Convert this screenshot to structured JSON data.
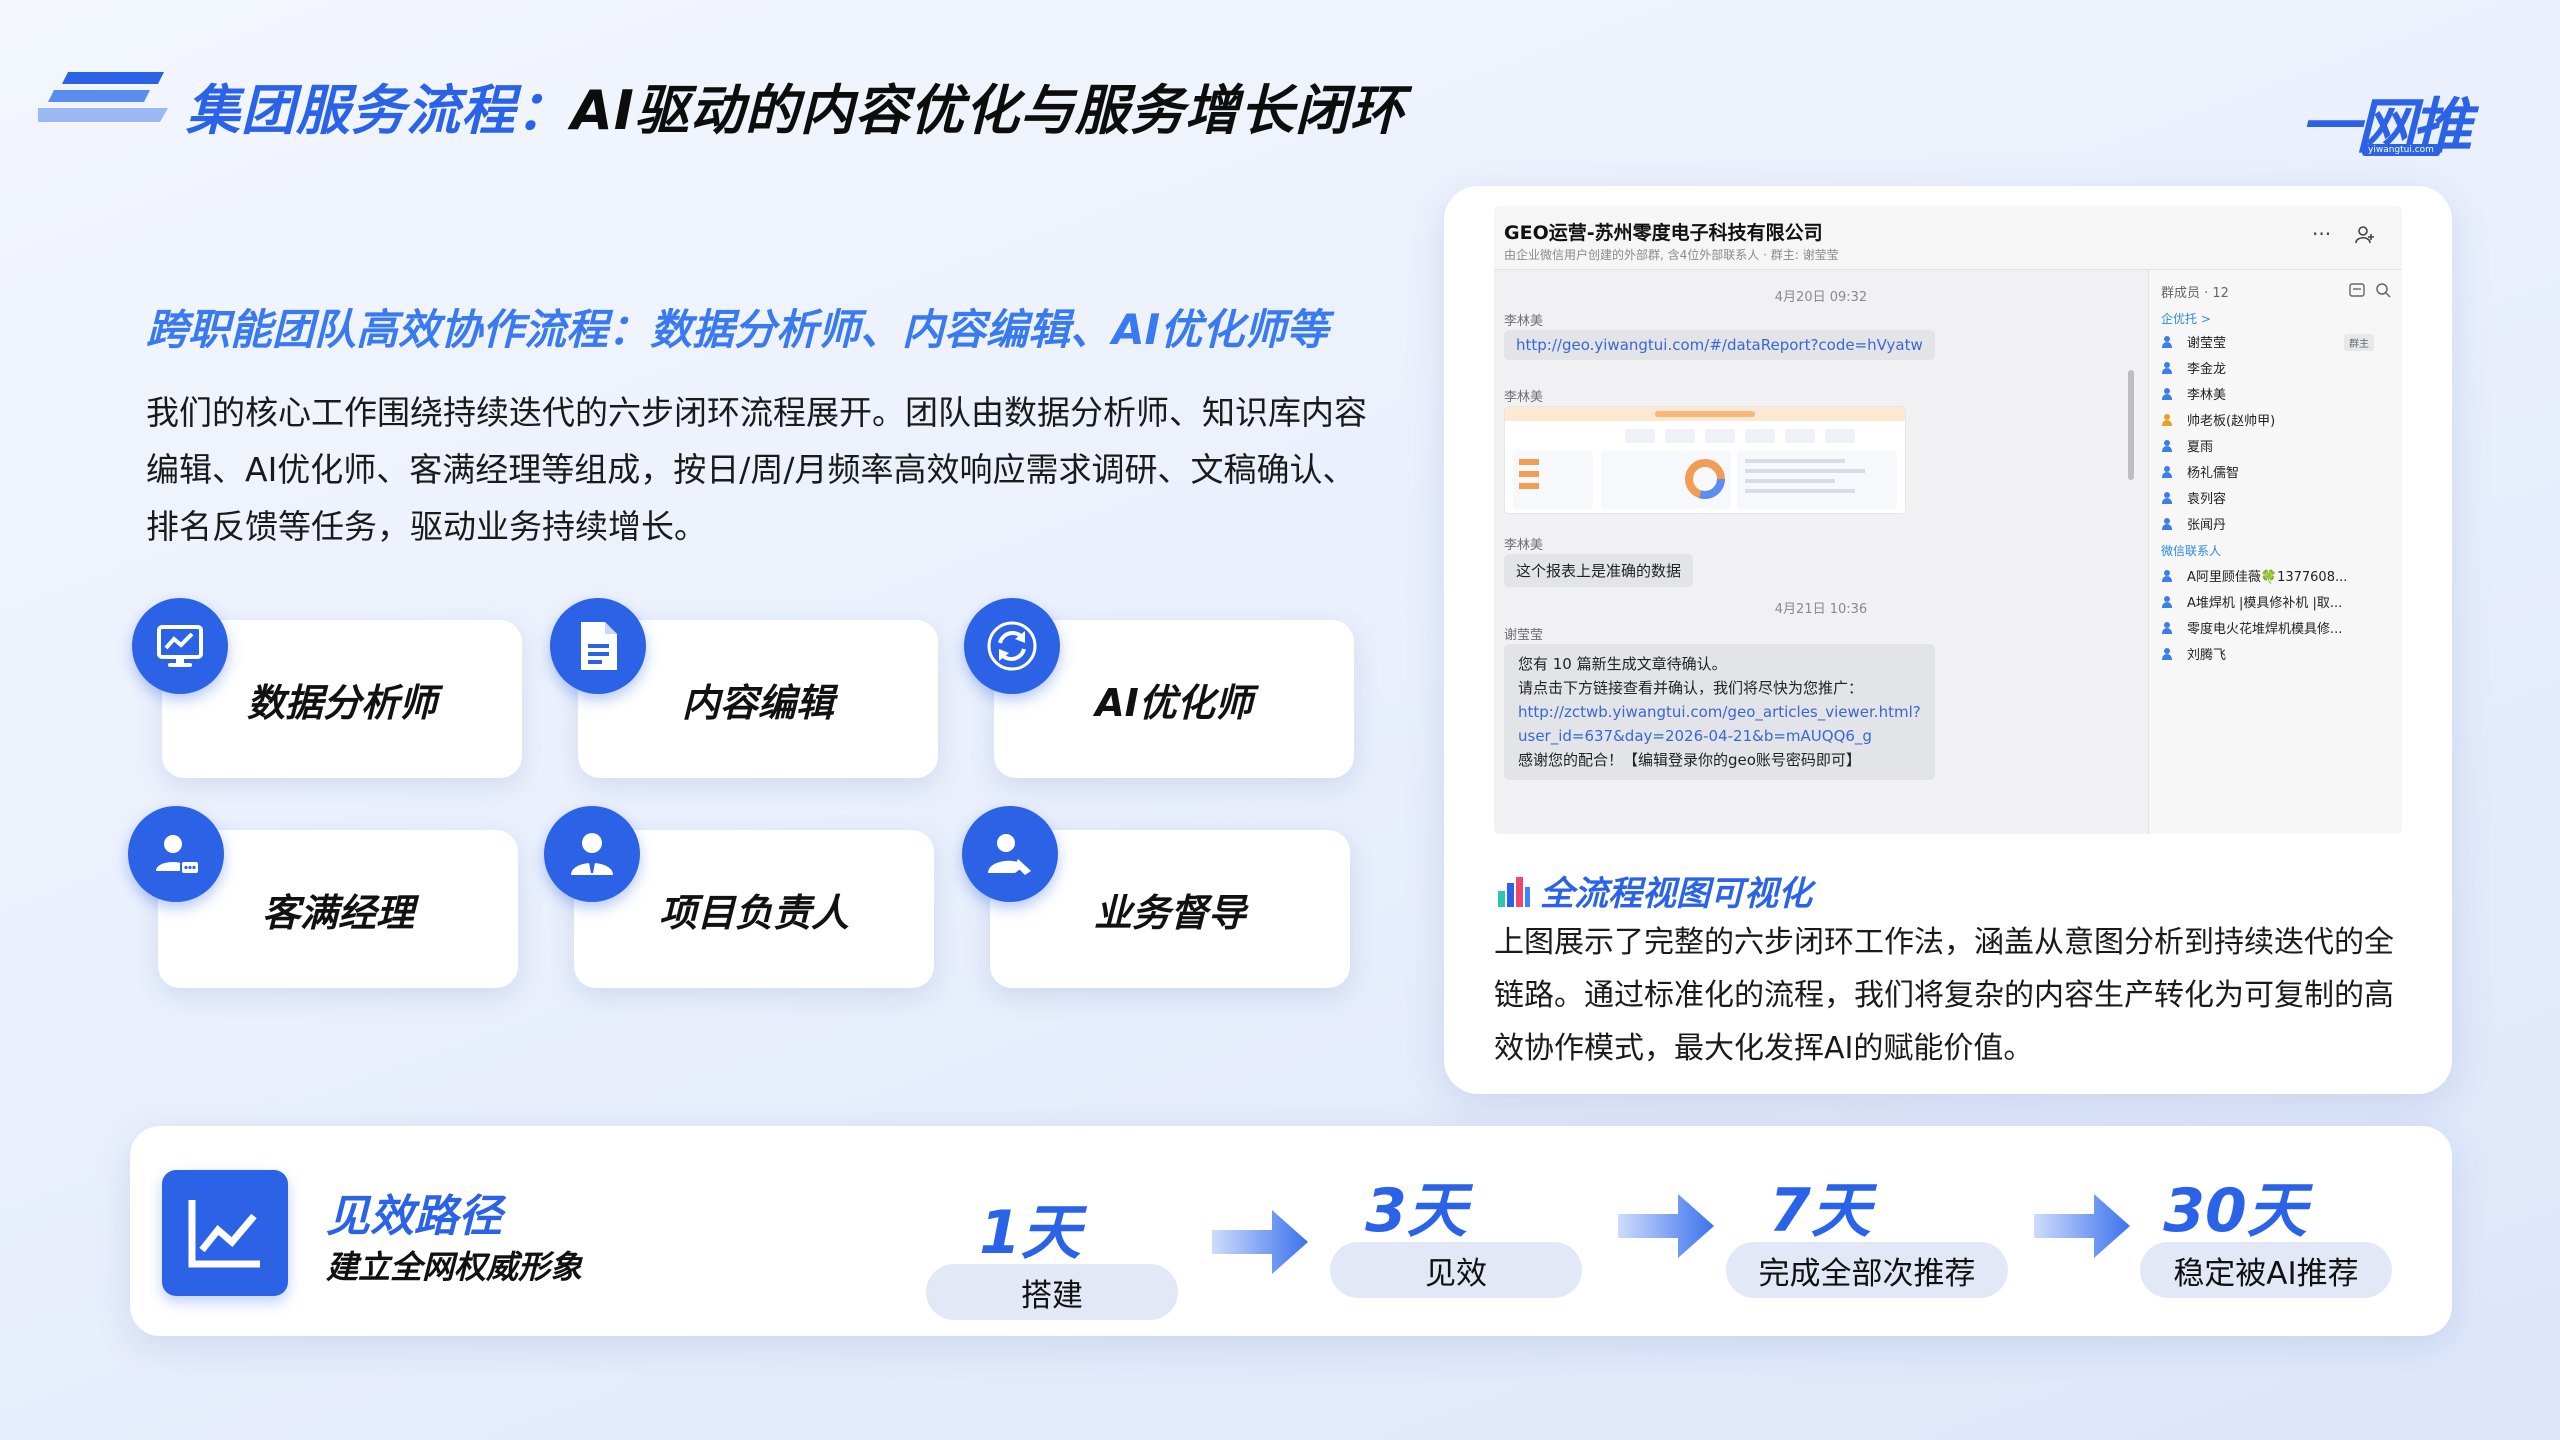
{
  "header": {
    "title_blue": "集团服务流程：",
    "title_dark": "AI驱动的内容优化与服务增长闭环",
    "logo_text": "一网推",
    "logo_sub": "yiwangtui.com"
  },
  "left": {
    "section_title": "跨职能团队高效协作流程：数据分析师、内容编辑、AI优化师等",
    "intro": "我们的核心工作围绕持续迭代的六步闭环流程展开。团队由数据分析师、知识库内容编辑、AI优化师、客满经理等组成，按日/周/月频率高效响应需求调研、文稿确认、排名反馈等任务，驱动业务持续增长。",
    "roles": [
      {
        "label": "数据分析师",
        "icon": "monitor-chart-icon"
      },
      {
        "label": "内容编辑",
        "icon": "document-icon"
      },
      {
        "label": "AI优化师",
        "icon": "refresh-cycle-icon"
      },
      {
        "label": "客满经理",
        "icon": "user-chat-icon"
      },
      {
        "label": "项目负责人",
        "icon": "manager-icon"
      },
      {
        "label": "业务督导",
        "icon": "supervisor-icon"
      }
    ]
  },
  "panel": {
    "chat": {
      "group_title": "GEO运营-苏州零度电子科技有限公司",
      "group_sub": "由企业微信用户创建的外部群, 含4位外部联系人 · 群主: 谢莹莹",
      "time1": "4月20日 09:32",
      "sender1": "李林美",
      "link1": "http://geo.yiwangtui.com/#/dataReport?code=hVyatw",
      "sender2": "李林美",
      "sender3": "李林美",
      "msg3": "这个报表上是准确的数据",
      "time2": "4月21日 10:36",
      "sender4": "谢莹莹",
      "msg4_line1": "您有 10 篇新生成文章待确认。",
      "msg4_line2": "请点击下方链接查看并确认，我们将尽快为您推广：",
      "msg4_link1": "http://zctwb.yiwangtui.com/geo_articles_viewer.html?",
      "msg4_link2": "user_id=637&day=2026-04-21&b=mAUQQ6_g",
      "msg4_line3": "感谢您的配合！【编辑登录你的geo账号密码即可】",
      "members_header": "群成员 · 12",
      "cat1": "企优托 >",
      "owner_tag": "群主",
      "members1": [
        "谢莹莹",
        "李金龙",
        "李林美",
        "帅老板(赵帅甲)",
        "夏雨",
        "杨礼儒智",
        "袁列容",
        "张闻丹"
      ],
      "cat2": "微信联系人",
      "members2": [
        "A阿里顾佳薇🍀1377608...",
        "A堆焊机 |模具修补机 |取...",
        "零度电火花堆焊机模具修...",
        "刘腾飞"
      ]
    },
    "feature_title": "全流程视图可视化",
    "feature_text": "上图展示了完整的六步闭环工作法，涵盖从意图分析到持续迭代的全链路。通过标准化的流程，我们将复杂的内容生产转化为可复制的高效协作模式，最大化发挥AI的赋能价值。"
  },
  "bottom": {
    "title": "见效路径",
    "subtitle": "建立全网权威形象",
    "steps": [
      {
        "num": "1天",
        "label": "搭建"
      },
      {
        "num": "3天",
        "label": "见效"
      },
      {
        "num": "7天",
        "label": "完成全部次推荐"
      },
      {
        "num": "30天",
        "label": "稳定被AI推荐"
      }
    ]
  }
}
